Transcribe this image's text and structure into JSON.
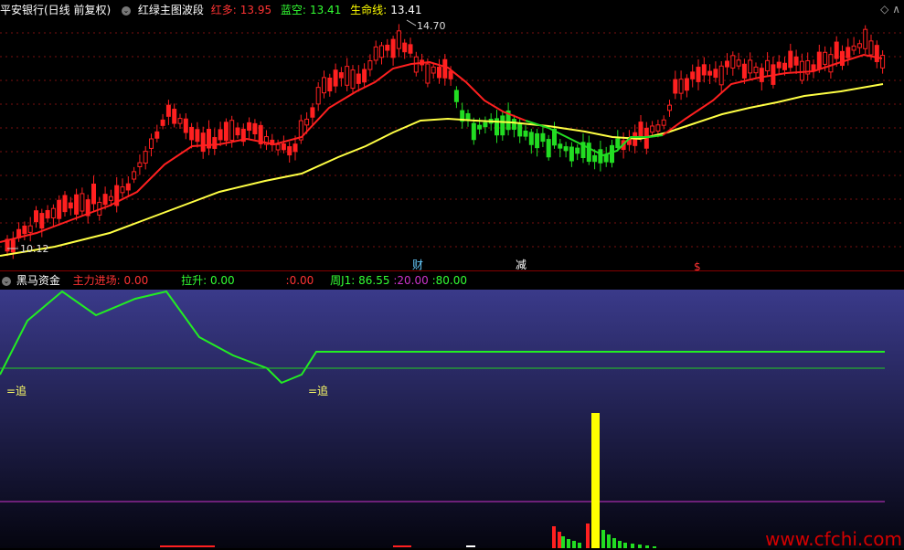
{
  "header": {
    "stock": "平安银行(日线 前复权)",
    "indicator": "红绿主图波段",
    "items": [
      {
        "label": "红多:",
        "value": "13.95",
        "label_color": "#ff3333",
        "value_color": "#ff3333"
      },
      {
        "label": "蓝空:",
        "value": "13.41",
        "label_color": "#33ff33",
        "value_color": "#33ff33"
      },
      {
        "label": "生命线:",
        "value": "13.41",
        "label_color": "#ffff00",
        "value_color": "#ffffff"
      }
    ]
  },
  "main_chart": {
    "high_label": "14.70",
    "low_label": "10.12",
    "markers": [
      {
        "text": "财",
        "color": "#66ccff"
      },
      {
        "text": "减",
        "color": "#ffffff"
      },
      {
        "text": "$",
        "color": "#ff3333"
      }
    ]
  },
  "indicator_panel": {
    "title": "黑马资金",
    "items": [
      {
        "label": "主力进场:",
        "value": "0.00",
        "color": "#ff3333"
      },
      {
        "label": "拉升:",
        "value": "0.00",
        "color": "#33ff33"
      },
      {
        "label": ":",
        "value": "0.00",
        "color": "#ff3333"
      },
      {
        "label": "周J1:",
        "value": "86.55",
        "color": "#33ff33"
      },
      {
        "label": ":",
        "value": "20.00",
        "color": "#cc33cc"
      },
      {
        "label": ":",
        "value": "80.00",
        "color": "#33ff33"
      }
    ],
    "chase_label": "=追"
  },
  "watermark": "www.cfchi.com",
  "colors": {
    "up": "#ff2020",
    "down": "#22dd22",
    "red_line": "#ff2020",
    "green_line": "#22dd22",
    "life_line": "#ffff44",
    "kdj_line": "#22ee22",
    "threshold": "#cc33cc"
  },
  "icons": {
    "eye": "eye-icon",
    "settings": "diamond-icon"
  }
}
